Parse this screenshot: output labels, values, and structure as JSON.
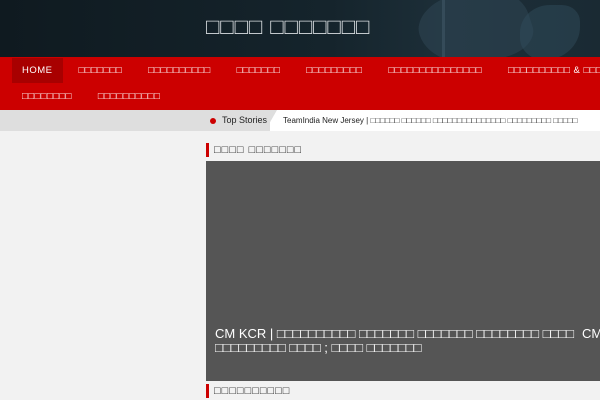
{
  "header": {
    "site_title": "□□□□ □□□□□□□"
  },
  "nav": {
    "row1": [
      {
        "label": "HOME",
        "active": true
      },
      {
        "label": "□□□□□□□"
      },
      {
        "label": "□□□□□□□□□□"
      },
      {
        "label": "□□□□□□□"
      },
      {
        "label": "□□□□□□□□□"
      },
      {
        "label": "□□□□□□□□□□□□□□□"
      },
      {
        "label": "□□□□□□□□□□ & □□□□□□"
      }
    ],
    "row2": [
      {
        "label": "□□□□□□□□"
      },
      {
        "label": "□□□□□□□□□□"
      }
    ]
  },
  "ticker": {
    "label": "Top Stories",
    "text": "TeamIndia New Jersey | □□□□□□ □□□□□□ □□□□□□□□□□□□□□□ □□□□□□□□□ □□□□□"
  },
  "sections": {
    "featured_heading": "□□□□ □□□□□□□",
    "second_heading": "□□□□□□□□□□"
  },
  "featured": {
    "caption": "CM KCR | □□□□□□□□□□ □□□□□□□ □□□□□□□ □□□□□□□□ □□□□ □□□□□□□□□ □□□□ ; □□□□ □□□□□□□",
    "peek": "CM"
  }
}
